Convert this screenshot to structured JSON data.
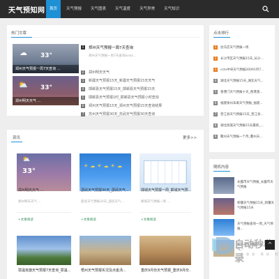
{
  "header": {
    "logo": "天气预知网",
    "nav": [
      "首页",
      "天气预报",
      "天气图表",
      "天气温度",
      "天气异常",
      "天气知识"
    ]
  },
  "hot": {
    "title": "热门文章",
    "featured": [
      {
        "caption": "郑州天气预报一周7天查询 ...",
        "temp": "33°"
      },
      {
        "caption": "郑州明天天气 ...",
        "temp": "33°"
      }
    ],
    "list": [
      {
        "num": "1",
        "title": "郑州天气预报一周7天查询",
        "desc": "郑州天气预报一周7天查询&nbs..."
      },
      {
        "num": "2",
        "title": "郑州明天天气"
      },
      {
        "num": "3",
        "title": "新疆天气预报15天_新疆天气预报15天天气"
      },
      {
        "num": "4",
        "title": "邯郸县天气预报15天_邯郸县天气预报15天"
      },
      {
        "num": "5",
        "title": "邯郸县天气预报1时_邯郸县天气预报小时查询"
      },
      {
        "num": "6",
        "title": "郑州天气预报15天_郑州天气预报15天查询结果"
      },
      {
        "num": "7",
        "title": "苏州天气预报30天_苏武天气预报30天查询"
      }
    ]
  },
  "ranking": {
    "title": "点击排行",
    "items": [
      {
        "num": "1",
        "text": "驻马店天气预报一周",
        "color": "#e67e22"
      },
      {
        "num": "2",
        "text": "长沙市区天气预报15天_长沙...",
        "color": "#e67e22"
      },
      {
        "num": "3",
        "text": "cctv中央天气预报20091月7...",
        "color": "#e67e22"
      },
      {
        "num": "4",
        "text": "湖北天气预报15天_湖北天气...",
        "color": "#888888"
      },
      {
        "num": "5",
        "text": "香港门天气预报十天_香港澳...",
        "color": "#888888"
      },
      {
        "num": "6",
        "text": "福建泉州未来天气预报_福建...",
        "color": "#888888"
      },
      {
        "num": "7",
        "text": "晋江县天气预报15天_晋江县...",
        "color": "#888888"
      },
      {
        "num": "8",
        "text": "湖北恩施天气预报15天最新_...",
        "color": "#888888"
      },
      {
        "num": "9",
        "text": "衢州天气预报一个月_衢州天...",
        "color": "#888888"
      }
    ]
  },
  "news": {
    "title": "资讯",
    "more": "更多>>",
    "cards": [
      {
        "title": "郑州明天天气 ...",
        "desc": "郑州明天天气 ...",
        "link": "+文章阅读",
        "temp": "33°"
      },
      {
        "title": "邵武天气预报30天_邵武天气...",
        "desc": "邵武天气预报30天_邵武天气...",
        "link": "+文章阅读",
        "temp": ""
      },
      {
        "title": "邯城天气预报一周_邯城天气预...",
        "desc": "邯城天气预报一周 ...",
        "link": "+文章阅读",
        "temp": ""
      },
      {
        "title": "鄂温克旗天气预报7天查询_鄂温...",
        "desc": "",
        "link": "",
        "temp": ""
      },
      {
        "title": "梧州天气预报实况及点金汤...",
        "desc": "",
        "link": "",
        "temp": ""
      },
      {
        "title": "重庆9月份天气预报_重庆9月份...",
        "desc": "",
        "link": "",
        "temp": ""
      }
    ]
  },
  "random": {
    "title": "随机内容",
    "items": [
      {
        "text": "长露市天气预报_长露市天气预报"
      },
      {
        "text": "新疆天气预报15天_新疆天气预报15天"
      },
      {
        "text": "天气预报查询一周_天气预报..."
      },
      {
        "text": "长沙天气预报15天_长沙天气..."
      }
    ]
  },
  "watermark": {
    "brand": "自动秒收录",
    "sub": "· 秒 收 录 · 来 访 · 秒 收 ·"
  },
  "backtop": "^",
  "colors": {
    "accent": "#1e90d6",
    "nav_bg": "#2b2b2b",
    "link_green": "#2e8b57",
    "rank_hot": "#e67e22"
  }
}
